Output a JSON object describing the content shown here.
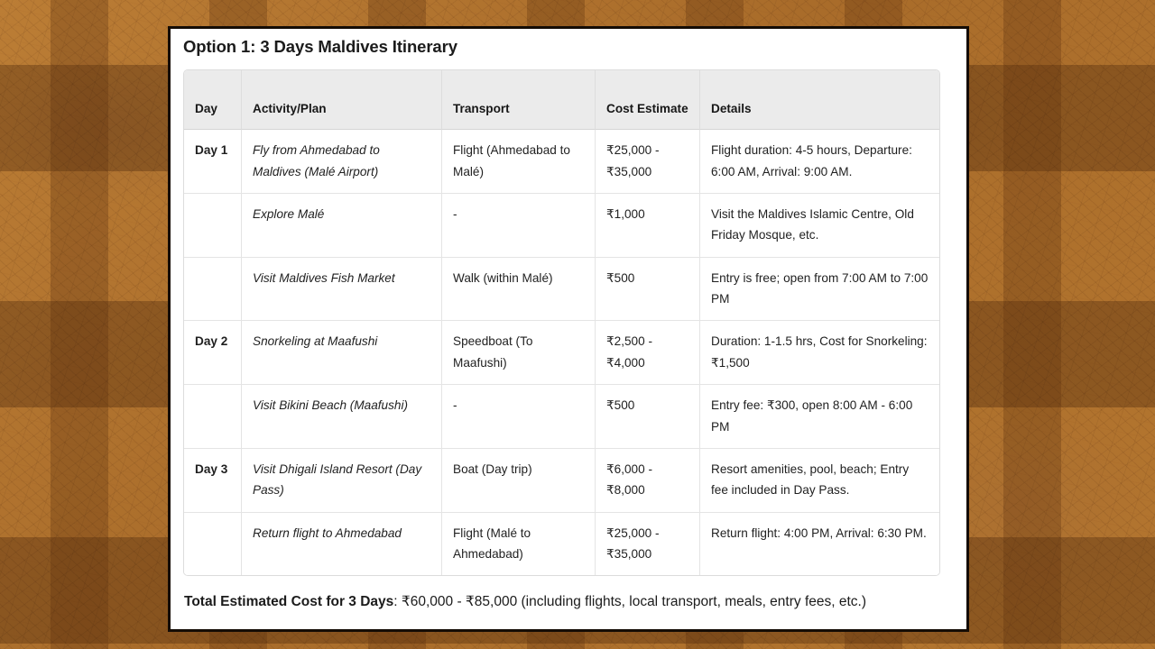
{
  "background": {
    "base_color": "#b0742f",
    "tile_color": "#5c2f0c"
  },
  "card": {
    "border_color": "#140c05",
    "background_color": "#ffffff"
  },
  "title": "Option 1: 3 Days Maldives Itinerary",
  "table": {
    "header_background": "#ebebeb",
    "columns": [
      "Day",
      "Activity/Plan",
      "Transport",
      "Cost Estimate",
      "Details"
    ],
    "rows": [
      {
        "day": "Day 1",
        "activity": "Fly from Ahmedabad to Maldives (Malé Airport)",
        "transport": "Flight (Ahmedabad to Malé)",
        "cost": "₹25,000 - ₹35,000",
        "details": "Flight duration: 4-5 hours, Departure: 6:00 AM, Arrival: 9:00 AM."
      },
      {
        "day": "",
        "activity": "Explore Malé",
        "transport": "-",
        "cost": "₹1,000",
        "details": "Visit the Maldives Islamic Centre, Old Friday Mosque, etc."
      },
      {
        "day": "",
        "activity": "Visit Maldives Fish Market",
        "transport": "Walk (within Malé)",
        "cost": "₹500",
        "details": "Entry is free; open from 7:00 AM to 7:00 PM"
      },
      {
        "day": "Day 2",
        "activity": "Snorkeling at Maafushi",
        "transport": "Speedboat (To Maafushi)",
        "cost": "₹2,500 - ₹4,000",
        "details": "Duration: 1-1.5 hrs, Cost for Snorkeling: ₹1,500"
      },
      {
        "day": "",
        "activity": "Visit Bikini Beach (Maafushi)",
        "transport": "-",
        "cost": "₹500",
        "details": "Entry fee: ₹300, open 8:00 AM - 6:00 PM"
      },
      {
        "day": "Day 3",
        "activity": "Visit Dhigali Island Resort (Day Pass)",
        "transport": "Boat (Day trip)",
        "cost": "₹6,000 - ₹8,000",
        "details": "Resort amenities, pool, beach; Entry fee included in Day Pass."
      },
      {
        "day": "",
        "activity": "Return flight to Ahmedabad",
        "transport": "Flight (Malé to Ahmedabad)",
        "cost": "₹25,000 - ₹35,000",
        "details": "Return flight: 4:00 PM, Arrival: 6:30 PM."
      }
    ]
  },
  "footer": {
    "label": "Total Estimated Cost for 3 Days",
    "value": ": ₹60,000 - ₹85,000 (including flights, local transport, meals, entry fees, etc.)"
  }
}
